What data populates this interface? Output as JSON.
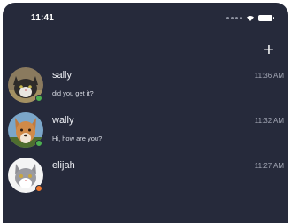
{
  "status_bar": {
    "time": "11:41"
  },
  "header": {
    "add_icon": "plus-icon",
    "add_label": "+"
  },
  "chats": [
    {
      "name": "sally",
      "time": "11:36 AM",
      "preview": "did you get it?",
      "status_color": "#4caf50",
      "avatar": "cat-avatar"
    },
    {
      "name": "wally",
      "time": "11:32 AM",
      "preview": "Hi, how are you?",
      "status_color": "#4caf50",
      "avatar": "dog-avatar"
    },
    {
      "name": "elijah",
      "time": "11:27 AM",
      "preview": "",
      "status_color": "#f0782d",
      "avatar": "cat-avatar"
    }
  ],
  "colors": {
    "background": "#262a3b",
    "online": "#4caf50",
    "away": "#f0782d"
  }
}
